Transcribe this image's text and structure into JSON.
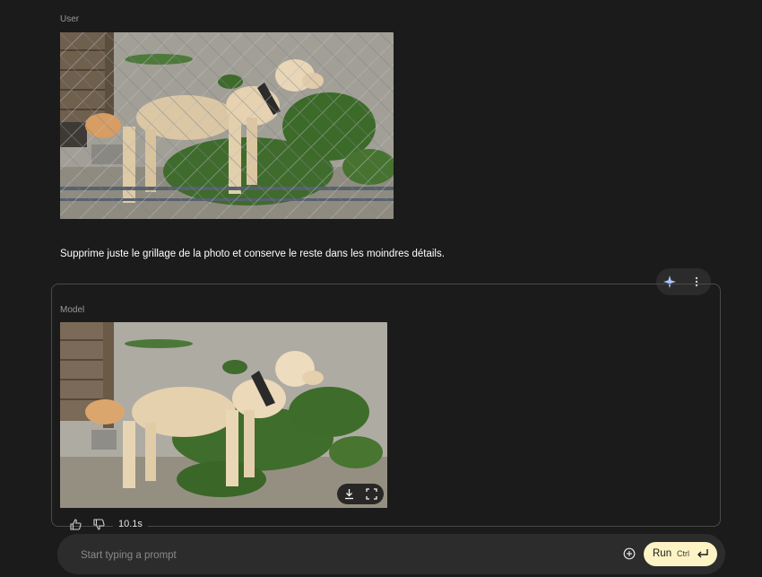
{
  "conversation": {
    "user_label": "User",
    "user_message": "Supprime juste le grillage de la photo et conserve le reste dans les moindres détails.",
    "model_label": "Model",
    "response_time": "10.1s"
  },
  "icons": {
    "sparkle": "sparkle-icon",
    "more": "more-vert-icon",
    "download": "download-icon",
    "fullscreen": "fullscreen-icon",
    "thumb_up": "thumb-up-icon",
    "thumb_down": "thumb-down-icon",
    "add": "add-circle-icon",
    "enter": "keyboard-return-icon"
  },
  "prompt": {
    "placeholder": "Start typing a prompt",
    "value": "",
    "run_label": "Run",
    "run_shortcut": "Ctrl"
  },
  "colors": {
    "background": "#1b1b1b",
    "run_button": "#fdf3c4",
    "sparkle": "#a8c7fa"
  }
}
